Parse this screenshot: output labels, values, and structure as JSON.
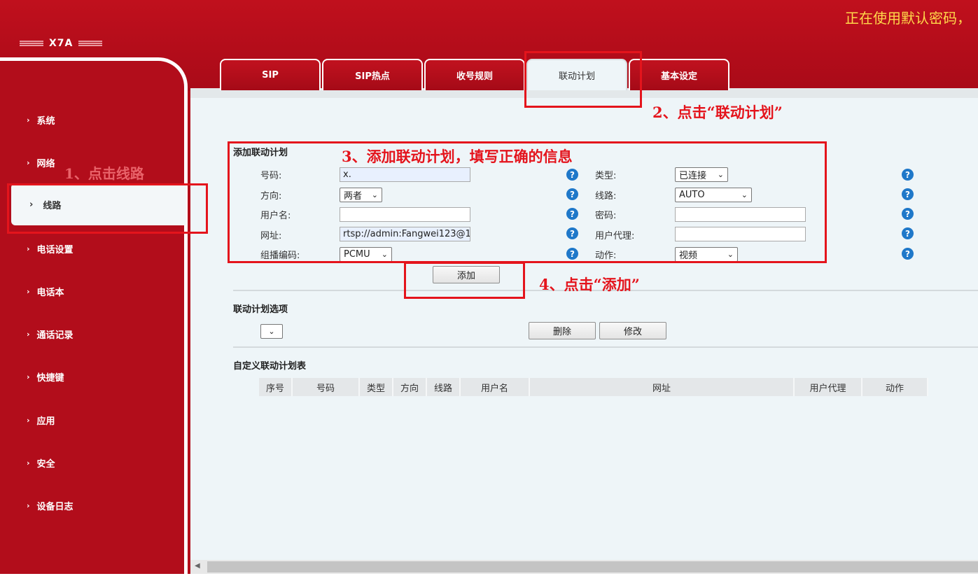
{
  "header": {
    "model": "X7A",
    "warning": "正在使用默认密码，"
  },
  "sidebar": {
    "items": [
      {
        "label": "系统"
      },
      {
        "label": "网络"
      },
      {
        "label": "线路"
      },
      {
        "label": "电话设置"
      },
      {
        "label": "电话本"
      },
      {
        "label": "通话记录"
      },
      {
        "label": "快捷键"
      },
      {
        "label": "应用"
      },
      {
        "label": "安全"
      },
      {
        "label": "设备日志"
      }
    ],
    "active_index": 2
  },
  "tabs": [
    {
      "label": "SIP"
    },
    {
      "label": "SIP热点"
    },
    {
      "label": "收号规则"
    },
    {
      "label": "联动计划"
    },
    {
      "label": "基本设定"
    }
  ],
  "add_section": {
    "title": "添加联动计划",
    "number_label": "号码:",
    "number_value": "x.",
    "direction_label": "方向:",
    "direction_value": "两者",
    "username_label": "用户名:",
    "username_value": "",
    "url_label": "网址:",
    "url_value": "rtsp://admin:Fangwei123@1",
    "codec_label": "组播编码:",
    "codec_value": "PCMU",
    "type_label": "类型:",
    "type_value": "已连接",
    "line_label": "线路:",
    "line_value": "AUTO",
    "password_label": "密码:",
    "password_value": "",
    "useragent_label": "用户代理:",
    "useragent_value": "",
    "action_label": "动作:",
    "action_value": "视频",
    "add_button": "添加"
  },
  "options_section": {
    "title": "联动计划选项",
    "select_value": "",
    "delete_button": "删除",
    "modify_button": "修改"
  },
  "table_section": {
    "title": "自定义联动计划表",
    "columns": [
      "序号",
      "号码",
      "类型",
      "方向",
      "线路",
      "用户名",
      "网址",
      "用户代理",
      "动作"
    ]
  },
  "annotations": {
    "step1": "1、点击线路",
    "step2": "2、点击“联动计划”",
    "step3": "3、添加联动计划，填写正确的信息",
    "step4": "4、点击“添加”"
  },
  "colors": {
    "brand_red": "#b20d1b",
    "annotation_red": "#e4141c",
    "warning_yellow": "#ffd84a",
    "help_blue": "#1f78c9"
  },
  "icons": {
    "help": "question-circle-icon",
    "chevron": "chevron-right-icon",
    "caret": "chevron-down-icon"
  }
}
